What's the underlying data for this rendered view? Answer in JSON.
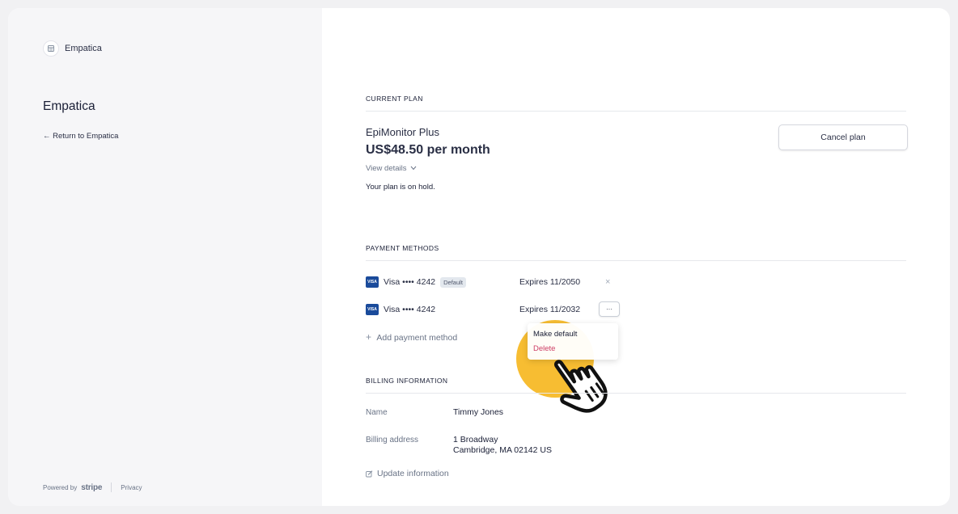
{
  "sidebar": {
    "brand_name": "Empatica",
    "merchant_title": "Empatica",
    "return_link": "← Return to Empatica",
    "footer": {
      "powered_by": "Powered by",
      "stripe": "stripe",
      "privacy": "Privacy"
    }
  },
  "current_plan": {
    "heading": "CURRENT PLAN",
    "name": "EpiMonitor Plus",
    "price": "US$48.50 per month",
    "view_details": "View details",
    "status": "Your plan is on hold.",
    "cancel_button": "Cancel plan"
  },
  "payment_methods": {
    "heading": "PAYMENT METHODS",
    "items": [
      {
        "brand": "VISA",
        "label": "Visa •••• 4242",
        "badge": "Default",
        "expiry": "Expires 11/2050",
        "remove_icon": "×"
      },
      {
        "brand": "VISA",
        "label": "Visa •••• 4242",
        "expiry": "Expires 11/2032",
        "more_icon": "···"
      }
    ],
    "add_label": "Add payment method",
    "menu": {
      "make_default": "Make default",
      "delete": "Delete"
    }
  },
  "billing": {
    "heading": "BILLING INFORMATION",
    "name_label": "Name",
    "name_value": "Timmy Jones",
    "address_label": "Billing address",
    "address_line1": "1 Broadway",
    "address_line2": "Cambridge, MA 02142 US",
    "update_label": "Update information"
  },
  "colors": {
    "highlight": "#f7b927",
    "delete_red": "#cd3d64",
    "visa_blue": "#1a4b9b"
  }
}
